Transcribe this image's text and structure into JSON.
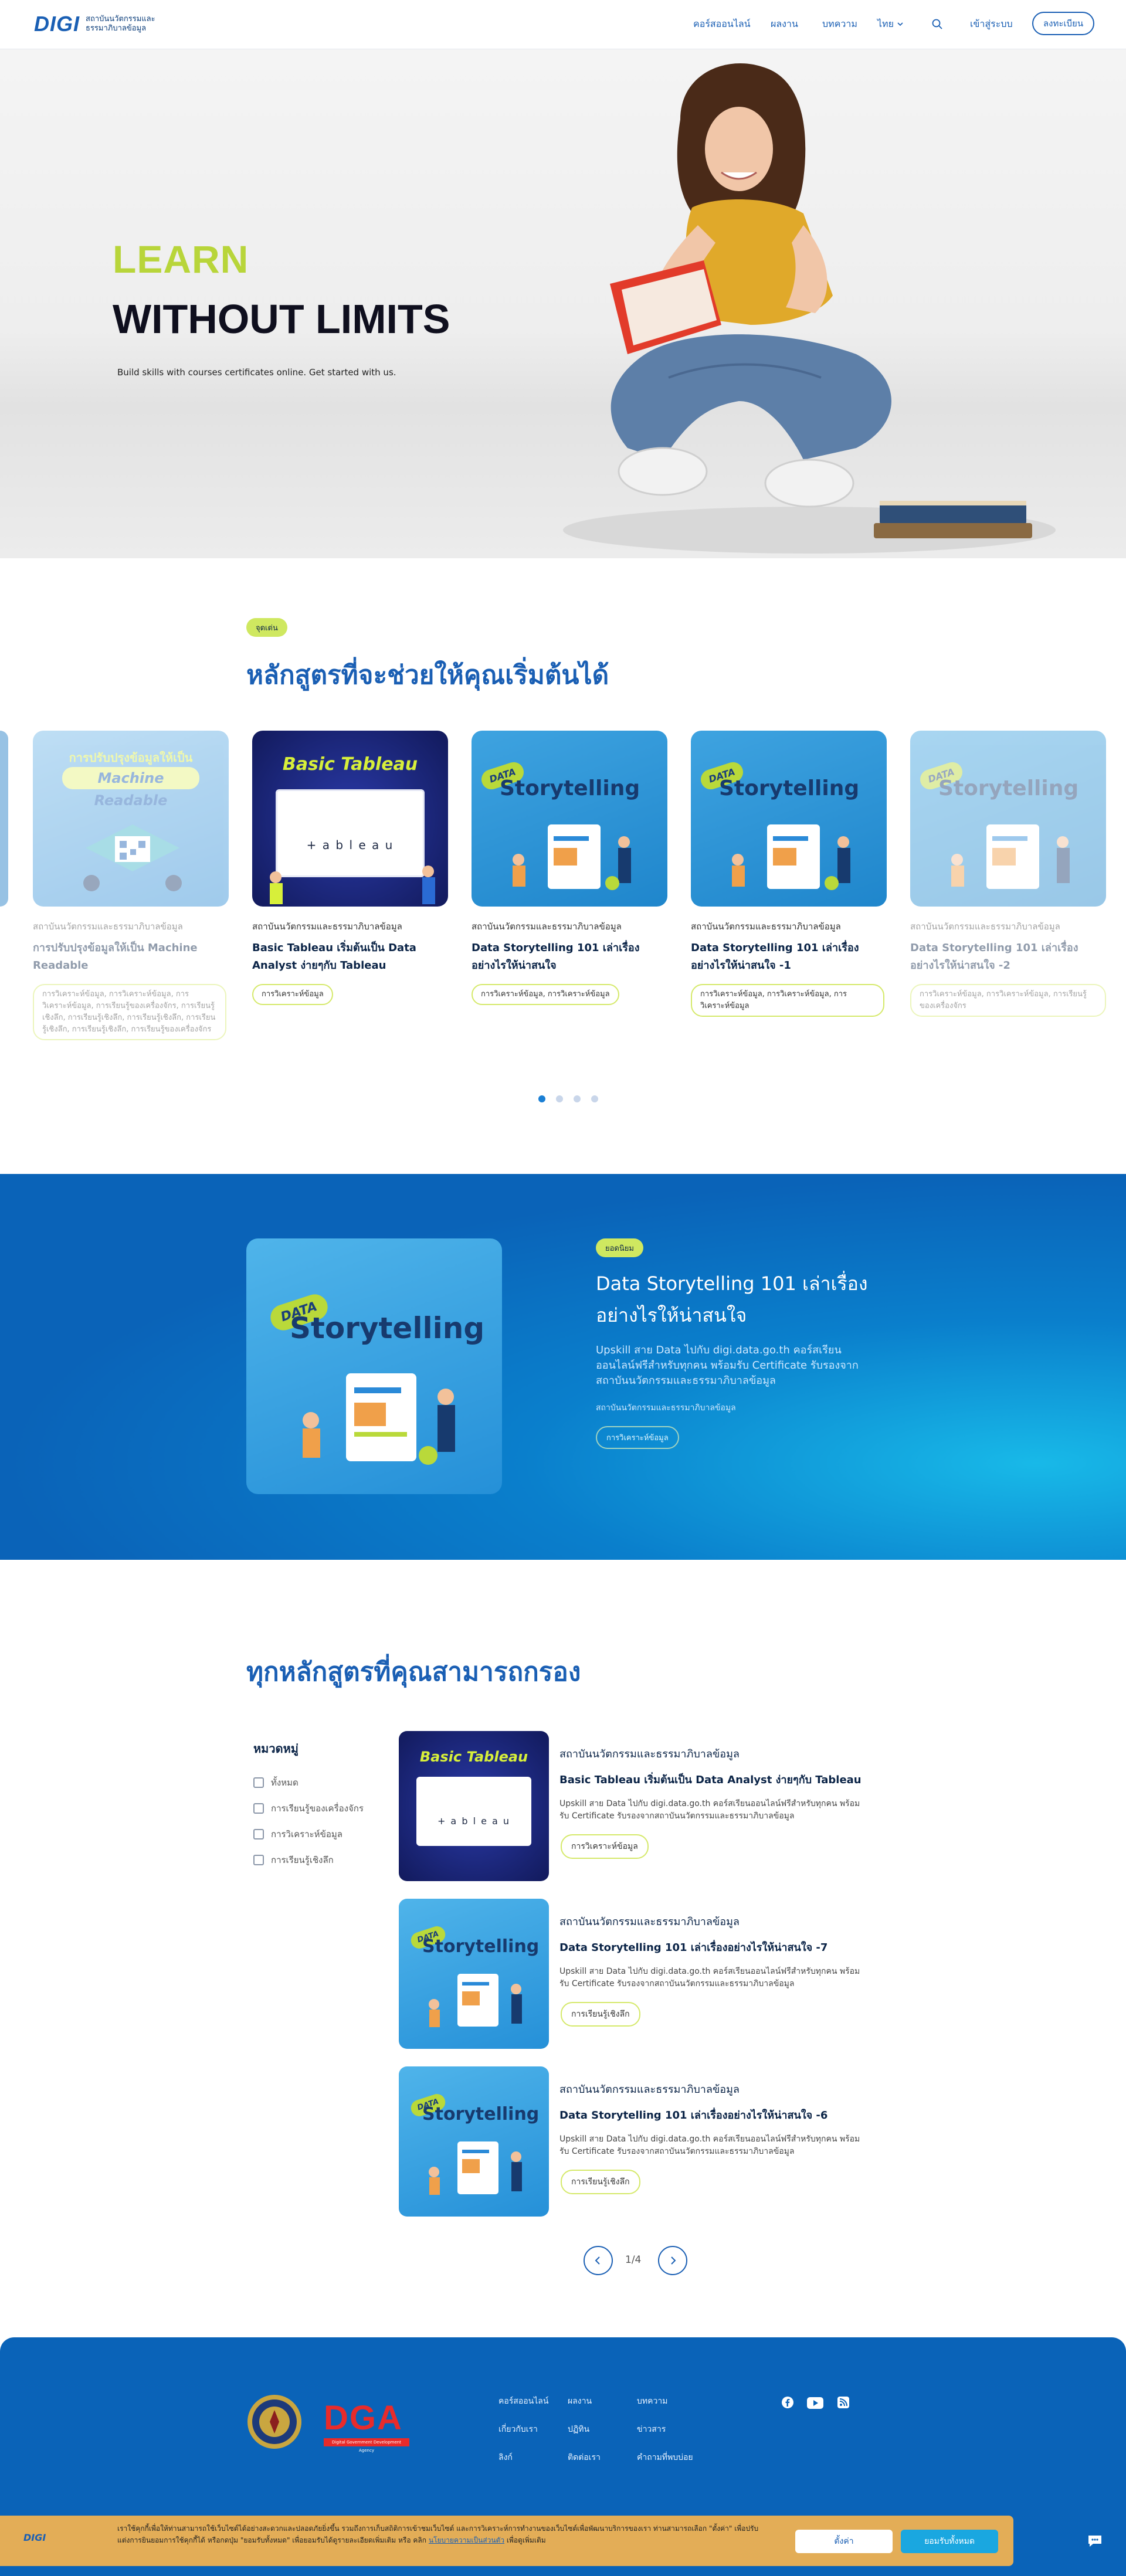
{
  "header": {
    "logo_mark": "DIGI",
    "logo_line1": "สถาบันนวัตกรรมและ",
    "logo_line2": "ธรรมาภิบาลข้อมูล",
    "nav": [
      "คอร์สออนไลน์",
      "ผลงาน",
      "บทความ"
    ],
    "language": "ไทย",
    "signin": "เข้าสู่ระบบ",
    "register": "ลงทะเบียน"
  },
  "hero": {
    "title_line1": "LEARN",
    "title_line2": "WITHOUT LIMITS",
    "subtitle": "Build skills with courses certificates online. Get started with us."
  },
  "popular": {
    "badge": "จุดเด่น",
    "title": "หลักสูตรที่จะช่วยให้คุณเริ่มต้นได้",
    "cards": [
      {
        "org": "สถาบันนวัตกรรมและธรรมาภิบาลข้อมูล",
        "title": "การปรับปรุงข้อมูลให้เป็น Machine Readable",
        "tags": "การวิเคราะห์ข้อมูล, การวิเคราะห์ข้อมูล, การวิเคราะห์ข้อมูล, การเรียนรู้ของเครื่องจักร, การเรียนรู้เชิงลึก, การเรียนรู้เชิงลึก, การเรียนรู้เชิงลึก, การเรียนรู้เชิงลึก, การเรียนรู้เชิงลึก, การเรียนรู้ของเครื่องจักร",
        "img_caption": "การปรับปรุงข้อมูลให้เป็น",
        "img_title": "Machine Readable"
      },
      {
        "org": "สถาบันนวัตกรรมและธรรมาภิบาลข้อมูล",
        "title": "Basic Tableau เริ่มต้นเป็น Data Analyst ง่ายๆกับ Tableau",
        "tags": "การวิเคราะห์ข้อมูล",
        "img_title": "Basic Tableau",
        "img_brand": "+ a b l e a u"
      },
      {
        "org": "สถาบันนวัตกรรมและธรรมาภิบาลข้อมูล",
        "title": "Data Storytelling 101 เล่าเรื่องอย่างไรให้น่าสนใจ",
        "tags": "การวิเคราะห์ข้อมูล, การวิเคราะห์ข้อมูล",
        "img_small": "DATA",
        "img_title": "Storytelling"
      },
      {
        "org": "สถาบันนวัตกรรมและธรรมาภิบาลข้อมูล",
        "title": "Data Storytelling 101 เล่าเรื่องอย่างไรให้น่าสนใจ -1",
        "tags": "การวิเคราะห์ข้อมูล, การวิเคราะห์ข้อมูล, การวิเคราะห์ข้อมูล",
        "img_small": "DATA",
        "img_title": "Storytelling"
      },
      {
        "org": "สถาบันนวัตกรรมและธรรมาภิบาลข้อมูล",
        "title": "Data Storytelling 101 เล่าเรื่องอย่างไรให้น่าสนใจ -2",
        "tags": "การวิเคราะห์ข้อมูล, การวิเคราะห์ข้อมูล, การเรียนรู้ของเครื่องจักร",
        "img_small": "DATA",
        "img_title": "Storytelling"
      }
    ]
  },
  "featured": {
    "badge": "ยอดนิยม",
    "title": "Data Storytelling 101 เล่าเรื่องอย่างไรให้น่าสนใจ",
    "description": "Upskill สาย Data ไปกับ digi.data.go.th คอร์สเรียนออนไลน์ฟรีสำหรับทุกคน พร้อมรับ Certificate รับรองจากสถาบันนวัตกรรมและธรรมาภิบาลข้อมูล",
    "org": "สถาบันนวัตกรรมและธรรมาภิบาลข้อมูล",
    "tag": "การวิเคราะห์ข้อมูล",
    "img_small": "DATA",
    "img_title": "Storytelling"
  },
  "all_courses": {
    "title": "ทุกหลักสูตรที่คุณสามารถกรอง",
    "filter_title": "หมวดหมู่",
    "filters": [
      "ทั้งหมด",
      "การเรียนรู้ของเครื่องจักร",
      "การวิเคราะห์ข้อมูล",
      "การเรียนรู้เชิงลึก"
    ],
    "rows": [
      {
        "org": "สถาบันนวัตกรรมและธรรมาภิบาลข้อมูล",
        "title": "Basic Tableau เริ่มต้นเป็น Data Analyst ง่ายๆกับ Tableau",
        "desc": "Upskill สาย Data ไปกับ digi.data.go.th คอร์สเรียนออนไลน์ฟรีสำหรับทุกคน พร้อมรับ Certificate รับรองจากสถาบันนวัตกรรมและธรรมาภิบาลข้อมูล",
        "tag": "การวิเคราะห์ข้อมูล",
        "img_title": "Basic Tableau",
        "img_brand": "+ a b l e a u"
      },
      {
        "org": "สถาบันนวัตกรรมและธรรมาภิบาลข้อมูล",
        "title": "Data Storytelling 101 เล่าเรื่องอย่างไรให้น่าสนใจ -7",
        "desc": "Upskill สาย Data ไปกับ digi.data.go.th คอร์สเรียนออนไลน์ฟรีสำหรับทุกคน พร้อมรับ Certificate รับรองจากสถาบันนวัตกรรมและธรรมาภิบาลข้อมูล",
        "tag": "การเรียนรู้เชิงลึก",
        "img_small": "DATA",
        "img_title": "Storytelling"
      },
      {
        "org": "สถาบันนวัตกรรมและธรรมาภิบาลข้อมูล",
        "title": "Data Storytelling 101 เล่าเรื่องอย่างไรให้น่าสนใจ -6",
        "desc": "Upskill สาย Data ไปกับ digi.data.go.th คอร์สเรียนออนไลน์ฟรีสำหรับทุกคน พร้อมรับ Certificate รับรองจากสถาบันนวัตกรรมและธรรมาภิบาลข้อมูล",
        "tag": "การเรียนรู้เชิงลึก",
        "img_small": "DATA",
        "img_title": "Storytelling"
      }
    ],
    "pagination": "1/4"
  },
  "footer": {
    "dga": "DGA",
    "dga_sub": "Digital Government Development Agency",
    "links": [
      "คอร์สออนไลน์",
      "ผลงาน",
      "บทความ",
      "เกี่ยวกับเรา",
      "ปฏิทิน",
      "ข่าวสาร",
      "ลิงก์",
      "ติดต่อเรา",
      "คำถามที่พบบ่อย"
    ]
  },
  "cookie": {
    "text": "เราใช้คุกกี้เพื่อให้ท่านสามารถใช้เว็บไซต์ได้อย่างสะดวกและปลอดภัยยิ่งขึ้น รวมถึงการเก็บสถิติการเข้าชมเว็บไซต์ และการวิเคราะห์การทำงานของเว็บไซต์เพื่อพัฒนาบริการของเรา ท่านสามารถเลือก \"ตั้งค่า\" เพื่อปรับแต่งการยินยอมการใช้คุกกี้ได้ หรือกดปุ่ม \"ยอมรับทั้งหมด\" เพื่อยอมรับได้ดูรายละเอียดเพิ่มเติม หรือ คลิก",
    "policy_link": "นโยบายความเป็นส่วนตัว",
    "text_end": "เพื่อดูเพิ่มเติม",
    "settings": "ตั้งค่า",
    "accept": "ยอมรับทั้งหมด"
  },
  "colors": {
    "brand": "#1a5fb4",
    "lime": "#b8d53a",
    "footer": "#0a63b8",
    "cookie": "#e3ad57"
  }
}
